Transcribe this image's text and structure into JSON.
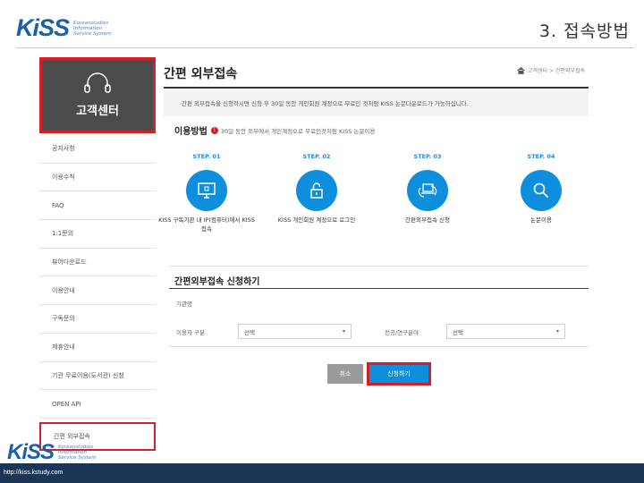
{
  "header": {
    "logo_text": "KiSS",
    "logo_sub": "Koreanstudies Information Service System",
    "slide_title": "3. 접속방법"
  },
  "sidebar": {
    "cs_label": "고객센터",
    "items": [
      {
        "label": "공지사항"
      },
      {
        "label": "이용수칙"
      },
      {
        "label": "FAQ"
      },
      {
        "label": "1:1문의"
      },
      {
        "label": "뷰어다운로드"
      },
      {
        "label": "이용안내"
      },
      {
        "label": "구독문의"
      },
      {
        "label": "제휴안내"
      },
      {
        "label": "기관 무료이용(도서관) 신청"
      },
      {
        "label": "OPEN API"
      },
      {
        "label": "간편 외부접속"
      }
    ]
  },
  "main": {
    "page_title": "간편 외부접속",
    "breadcrumb": "고객센터 > 간편외부접속",
    "notice": "간편 외부접속을 신청하시면 신청 후 30일 동안 개인회원 계정으로 무료인 것처럼 KISS 논문다운로드가 가능하십니다.",
    "usage_title": "이용방법",
    "usage_badge": "!",
    "usage_desc": "30일 동안 외부에서 개인계정으로 무료인것처럼 KISS 논문이용",
    "steps": [
      {
        "label": "STEP. 01",
        "icon": "monitor-icon",
        "desc": "KISS 구독기관 내 IP(컴퓨터)에서 KISS 접속"
      },
      {
        "label": "STEP. 02",
        "icon": "lock-icon",
        "desc": "KISS 개인회원 계정으로 로그인"
      },
      {
        "label": "STEP. 03",
        "icon": "laptop-sync-icon",
        "desc": "간편외부접속 신청"
      },
      {
        "label": "STEP. 04",
        "icon": "search-icon",
        "desc": "논문이용"
      }
    ],
    "apply_title": "간편외부접속 신청하기",
    "institution_label": "기관명",
    "user_type_label": "이용자 구분",
    "user_type_value": "선택",
    "research_field_label": "전공/연구분야",
    "research_field_value": "선택",
    "cancel_label": "취소",
    "apply_label": "신청하기"
  },
  "footer": {
    "logo_text": "KiSS",
    "logo_sub": "Koreanstudies Information Service System",
    "url": "http://kiss.kstudy.com"
  },
  "colors": {
    "brand_blue": "#1d5fa8",
    "step_blue": "#0d8fde",
    "highlight_red": "#d32026",
    "sidebar_dark": "#4b4b4b",
    "footer_navy": "#1b3556"
  }
}
